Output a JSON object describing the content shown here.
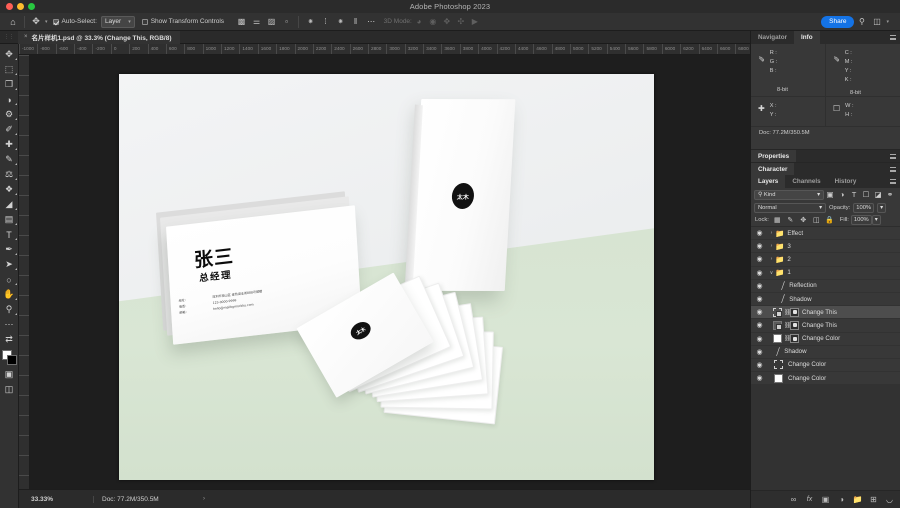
{
  "window": {
    "app_title": "Adobe Photoshop 2023",
    "traffic_lights": [
      "close",
      "minimize",
      "zoom"
    ]
  },
  "options_bar": {
    "home_icon": "home-icon",
    "active_tool_icon": "move-tool-icon",
    "tool_preset_caret": "▾",
    "auto_select": {
      "label": "Auto-Select:",
      "checked": true
    },
    "auto_select_scope": {
      "value": "Layer",
      "caret": "▾"
    },
    "show_transform_controls": {
      "label": "Show Transform Controls",
      "checked": false
    },
    "align_icons": [
      "align-left-edges-icon",
      "align-horizontal-centers-icon",
      "align-right-edges-icon",
      "align-top-edges-icon",
      "distribute-top-icon",
      "distribute-vertical-center-icon",
      "distribute-bottom-icon",
      "distribute-spacing-icon"
    ],
    "more_icon": "ellipsis-icon",
    "mode_3d_label": "3D Mode:",
    "mode_3d_icons": [
      "orbit-3d-icon",
      "roll-3d-icon",
      "pan-3d-icon",
      "slide-3d-icon",
      "camera-3d-icon"
    ],
    "share_label": "Share",
    "search_icon": "search-icon",
    "workspace_icon": "workspace-switcher-icon",
    "workspace_caret": "▾"
  },
  "document_tab": {
    "close_glyph": "×",
    "title": "名片样机1.psd @ 33.3% (Change This, RGB/8)"
  },
  "toolbar": {
    "tools": [
      {
        "name": "move-tool",
        "glyph": "✥"
      },
      {
        "name": "marquee-tool",
        "glyph": "⬚"
      },
      {
        "name": "lasso-tool",
        "glyph": "✒"
      },
      {
        "name": "object-selection-tool",
        "glyph": "◑"
      },
      {
        "name": "crop-tool",
        "glyph": "⌙"
      },
      {
        "name": "frame-tool",
        "glyph": "◱"
      },
      {
        "name": "eyedropper-tool",
        "glyph": "✐"
      },
      {
        "name": "spot-healing-tool",
        "glyph": "⊕"
      },
      {
        "name": "brush-tool",
        "glyph": "✎"
      },
      {
        "name": "clone-stamp-tool",
        "glyph": "⚑"
      },
      {
        "name": "history-brush-tool",
        "glyph": "❧"
      },
      {
        "name": "eraser-tool",
        "glyph": "◢"
      },
      {
        "name": "gradient-tool",
        "glyph": "▤"
      },
      {
        "name": "blur-tool",
        "glyph": "◌"
      },
      {
        "name": "dodge-tool",
        "glyph": "◔"
      },
      {
        "name": "pen-tool",
        "glyph": "✒"
      },
      {
        "name": "type-tool",
        "glyph": "T"
      },
      {
        "name": "path-selection-tool",
        "glyph": "➤"
      },
      {
        "name": "direct-selection-tool",
        "glyph": "⮜"
      },
      {
        "name": "shape-tool",
        "glyph": "○"
      },
      {
        "name": "hand-tool",
        "glyph": "✋"
      },
      {
        "name": "zoom-tool",
        "glyph": "⌕"
      },
      {
        "name": "edit-toolbar",
        "glyph": "…"
      }
    ],
    "foreground_color": "#ffffff",
    "background_color": "#000000",
    "swap_colors_icon": "swap-colors-icon",
    "default_colors_icon": "default-colors-icon",
    "quick_mask_icon": "quick-mask-icon",
    "screen_mode_icon": "screen-mode-icon"
  },
  "rulers": {
    "unit": "px",
    "h_ticks": [
      "-1000",
      "-800",
      "-600",
      "-400",
      "-200",
      "0",
      "200",
      "400",
      "600",
      "800",
      "1000",
      "1200",
      "1400",
      "1600",
      "1800",
      "2000",
      "2200",
      "2400",
      "2600",
      "2800",
      "3000",
      "3200",
      "3400",
      "3600",
      "3800",
      "4000",
      "4200",
      "4400",
      "4600",
      "4800",
      "5000",
      "5200",
      "5400",
      "5600",
      "5800",
      "6000",
      "6200",
      "6400",
      "6600",
      "6800"
    ]
  },
  "canvas": {
    "zoom": "33.33%",
    "backdrop_wall_color": "#eef0f1",
    "backdrop_floor_color": "#d8e5d3",
    "cards": {
      "landscape_card": {
        "name": "张三",
        "title": "总经理",
        "contact_labels": [
          "地址：",
          "电话：",
          "邮箱："
        ],
        "contact_lines": [
          "地址：深圳市南山区 金色商业街888号裙楼",
          "电话：123-0000-9999",
          "邮箱：hello@mailbgmockku.com"
        ]
      },
      "standing_card": {
        "logo_text": "太木"
      },
      "fanned_stack": {
        "logo_text": "太木"
      }
    }
  },
  "status_bar": {
    "zoom_level": "33.33%",
    "doc_size_label": "Doc: 77.2M/350.5M",
    "expand_arrow": "›"
  },
  "panels": {
    "navigator_info": {
      "tabs": [
        {
          "label": "Navigator",
          "active": false
        },
        {
          "label": "Info",
          "active": true
        }
      ],
      "menu_icon": "panel-menu-icon",
      "rgb": {
        "icon": "eyedropper-icon",
        "rows": [
          "R :",
          "G :",
          "B :"
        ],
        "depth": "8-bit"
      },
      "cmyk": {
        "icon": "eyedropper-icon",
        "rows": [
          "C :",
          "M :",
          "Y :",
          "K :"
        ],
        "depth": "8-bit"
      },
      "position": {
        "icon": "crosshair-icon",
        "rows": [
          "X :",
          "Y :"
        ]
      },
      "dimensions": {
        "icon": "selection-bounds-icon",
        "rows": [
          "W :",
          "H :"
        ]
      },
      "doc_line": "Doc: 77.2M/350.5M"
    },
    "properties": {
      "label": "Properties",
      "menu_icon": "panel-menu-icon"
    },
    "character": {
      "label": "Character",
      "menu_icon": "panel-menu-icon"
    },
    "layers": {
      "tabs": [
        {
          "label": "Layers",
          "active": true
        },
        {
          "label": "Channels",
          "active": false
        },
        {
          "label": "History",
          "active": false
        }
      ],
      "menu_icon": "panel-menu-icon",
      "filter": {
        "kind_label": "Kind",
        "search_icon": "search-icon",
        "caret": "▾",
        "filter_icons": [
          "pixel-layers-filter-icon",
          "adjustment-layers-filter-icon",
          "type-layers-filter-icon",
          "shape-layers-filter-icon",
          "smart-object-filter-icon",
          "filter-toggle-icon"
        ]
      },
      "blend": {
        "mode": "Normal",
        "caret": "▾",
        "opacity_label": "Opacity:",
        "opacity_value": "100%",
        "opacity_caret": "▾"
      },
      "lock": {
        "label": "Lock:",
        "icons": [
          "lock-transparent-pixels-icon",
          "lock-image-pixels-icon",
          "lock-position-icon",
          "lock-artboard-nesting-icon",
          "lock-all-icon"
        ],
        "fill_label": "Fill:",
        "fill_value": "100%",
        "fill_caret": "▾"
      },
      "rows": [
        {
          "name": "Effect",
          "type": "group",
          "indent": 0,
          "collapsed": true,
          "visible": true,
          "selected": false
        },
        {
          "name": "3",
          "type": "group",
          "indent": 0,
          "collapsed": true,
          "visible": true,
          "selected": false
        },
        {
          "name": "2",
          "type": "group",
          "indent": 0,
          "collapsed": true,
          "visible": true,
          "selected": false
        },
        {
          "name": "1",
          "type": "group",
          "indent": 0,
          "collapsed": false,
          "visible": true,
          "selected": false
        },
        {
          "name": "Reflection",
          "type": "brush",
          "indent": 1,
          "visible": true,
          "selected": false
        },
        {
          "name": "Shadow",
          "type": "brush",
          "indent": 1,
          "visible": true,
          "selected": false
        },
        {
          "name": "Change This",
          "type": "smart-masked",
          "indent": 1,
          "visible": true,
          "selected": true
        },
        {
          "name": "Change This",
          "type": "smart-masked",
          "indent": 1,
          "visible": true,
          "selected": false
        },
        {
          "name": "Change Color",
          "type": "solid-masked",
          "indent": 1,
          "visible": true,
          "selected": false
        },
        {
          "name": "Shadow",
          "type": "brush",
          "indent": 0,
          "visible": true,
          "selected": false
        },
        {
          "name": "Change Color",
          "type": "frame",
          "indent": 0,
          "visible": true,
          "selected": false
        },
        {
          "name": "Change Color",
          "type": "solid",
          "indent": 0,
          "visible": true,
          "selected": false
        }
      ],
      "footer_icons": [
        "link-layers-icon",
        "add-layer-style-icon",
        "add-layer-mask-icon",
        "new-fill-adjustment-icon",
        "new-group-icon",
        "new-layer-icon",
        "delete-layer-icon"
      ],
      "footer_glyphs": [
        "∞",
        "fx",
        "▣",
        "◑",
        "⬚",
        "⊞",
        "Ὕ1"
      ]
    }
  }
}
